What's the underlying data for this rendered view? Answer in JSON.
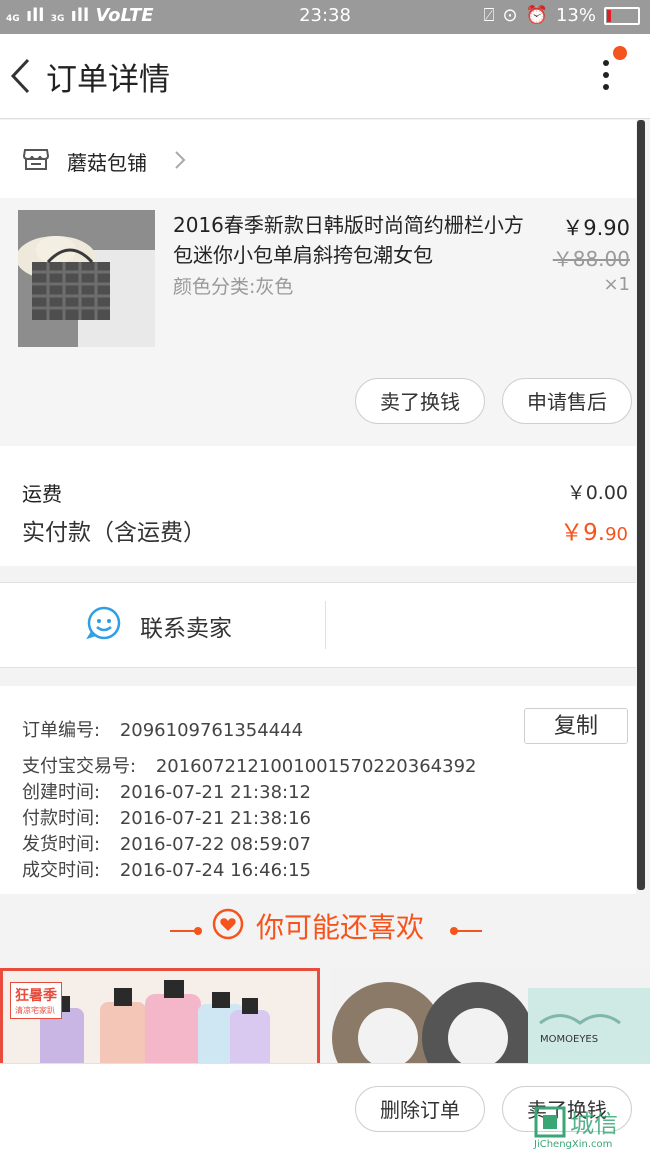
{
  "status_bar": {
    "network": "VoLTE",
    "time": "23:38",
    "battery": "13%",
    "signal_label_1": "4G",
    "signal_label_2": "3G"
  },
  "header": {
    "title": "订单详情"
  },
  "shop": {
    "name": "蘑菇包铺"
  },
  "product": {
    "title": "2016春季新款日韩版时尚简约栅栏小方包迷你小包单肩斜挎包潮女包",
    "spec": "颜色分类:灰色",
    "price": "￥9.90",
    "original_price": "￥88.00",
    "quantity": "×1",
    "sell_button": "卖了换钱",
    "after_sale_button": "申请售后"
  },
  "fees": {
    "shipping_label": "运费",
    "shipping_value": "￥0.00",
    "paid_label": "实付款（含运费）",
    "paid_value_main": "￥9.",
    "paid_value_cents": "90"
  },
  "contact": {
    "label": "联系卖家"
  },
  "order_info": {
    "copy_button": "复制",
    "rows": [
      {
        "label": "订单编号:",
        "value": "2096109761354444"
      },
      {
        "label": "支付宝交易号:",
        "value": "2016072121001001570220364392"
      },
      {
        "label": "创建时间:",
        "value": "2016-07-21 21:38:12"
      },
      {
        "label": "付款时间:",
        "value": "2016-07-21 21:38:16"
      },
      {
        "label": "发货时间:",
        "value": "2016-07-22 08:59:07"
      },
      {
        "label": "成交时间:",
        "value": "2016-07-24 16:46:15"
      }
    ]
  },
  "recommend": {
    "title": "你可能还喜欢",
    "card1_badge": "狂暑季",
    "card1_sub": "清凉宅家趴",
    "card2_brand": "MOMOEYES"
  },
  "bottom_bar": {
    "delete_button": "删除订单",
    "sell_button": "卖了换钱"
  },
  "watermark": {
    "text": "城信",
    "domain": "JiChengXin.com"
  },
  "colors": {
    "accent": "#f5551d",
    "contact_icon": "#2f9ee6"
  }
}
